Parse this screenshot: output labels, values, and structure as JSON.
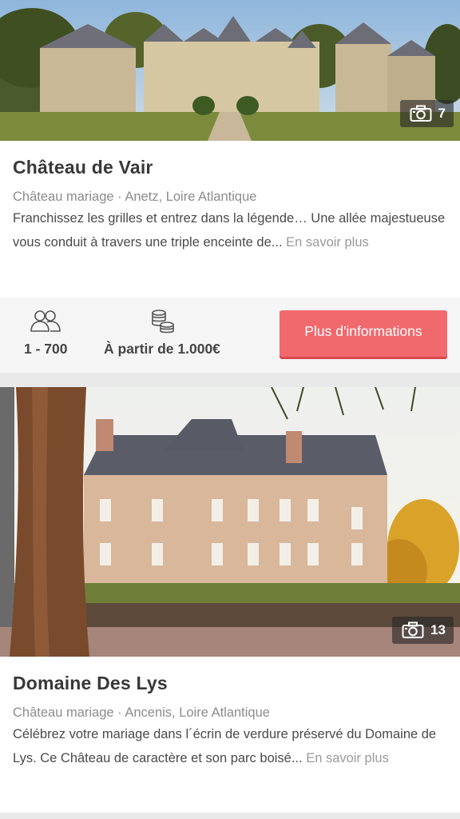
{
  "listings": [
    {
      "title": "Château de Vair",
      "category": "Château mariage · Anetz, Loire Atlantique",
      "description": "Franchissez les grilles et entrez dans la légende… Une allée majestueuse vous conduit à travers une triple enceinte de...",
      "more_link": "En savoir plus",
      "photo_count": "7",
      "capacity": "1 - 700",
      "price": "À partir de 1.000€",
      "cta_label": "Plus d'informations"
    },
    {
      "title": "Domaine Des Lys",
      "category": "Château mariage · Ancenis, Loire Atlantique",
      "description": "Célébrez votre mariage dans l´écrin de verdure préservé du Domaine de Lys. Ce Château de caractère et son parc boisé...",
      "more_link": "En savoir plus",
      "photo_count": "13"
    }
  ],
  "icons": {
    "photo_count": "camera-icon",
    "capacity": "people-icon",
    "price": "coins-icon"
  },
  "colors": {
    "cta": "#f0696d",
    "title": "#383838",
    "muted": "#8c8c8c"
  }
}
